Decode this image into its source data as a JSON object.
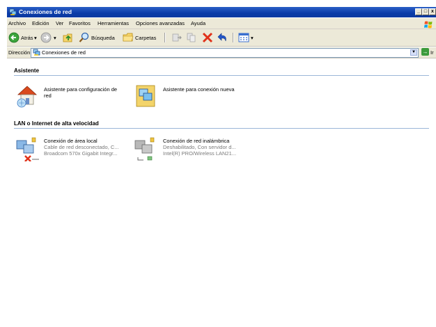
{
  "window": {
    "title": "Conexiones de red",
    "buttons": {
      "minimize": "_",
      "maximize": "□",
      "close": "x"
    }
  },
  "menubar": {
    "items": [
      "Archivo",
      "Edición",
      "Ver",
      "Favoritos",
      "Herramientas",
      "Opciones avanzadas",
      "Ayuda"
    ]
  },
  "toolbar": {
    "back_label": "Atrás",
    "search_label": "Búsqueda",
    "folders_label": "Carpetas"
  },
  "address": {
    "label": "Dirección",
    "value": "Conexiones de red",
    "go_label": "Ir"
  },
  "groups": [
    {
      "title": "Asistente",
      "items": [
        {
          "name": "Asistente para configuración de red"
        },
        {
          "name": "Asistente para conexión nueva"
        }
      ]
    },
    {
      "title": "LAN o Internet de alta velocidad",
      "items": [
        {
          "name": "Conexión de área local",
          "line1": "Cable de red desconectado, C...",
          "line2": "Broadcom 570x Gigabit Integr..."
        },
        {
          "name": "Conexión de red inalámbrica",
          "line1": "Deshabilitado, Con servidor d...",
          "line2": "Intel(R) PRO/Wireless LAN21..."
        }
      ]
    }
  ],
  "colors": {
    "titlebar": "#0a3ba8",
    "chrome": "#ece9d8",
    "group_line": "#9bb6d8",
    "subtext": "#7a7a7a"
  }
}
